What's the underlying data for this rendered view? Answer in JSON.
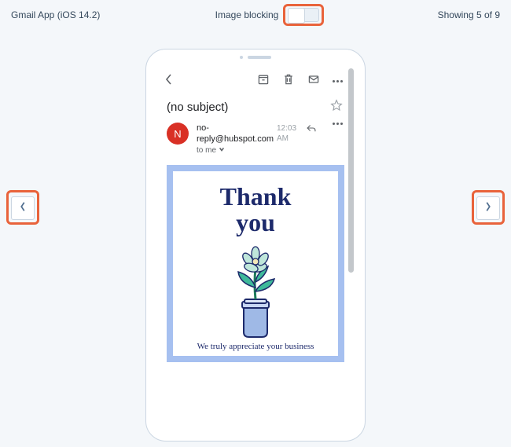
{
  "topbar": {
    "client_label": "Gmail App (iOS 14.2)",
    "toggle_label": "Image blocking",
    "counter": "Showing 5 of 9"
  },
  "email": {
    "subject": "(no subject)",
    "sender_avatar_initial": "N",
    "sender_address": "no-reply@hubspot.com",
    "sent_time": "12:03 AM",
    "to_label": "to me",
    "body_heading_line1": "Thank",
    "body_heading_line2": "you",
    "body_tagline": "We truly appreciate your business"
  },
  "colors": {
    "highlight": "#e9633b",
    "email_border": "#a6c0f0",
    "heading": "#1d2a6b",
    "avatar_bg": "#d93025"
  }
}
